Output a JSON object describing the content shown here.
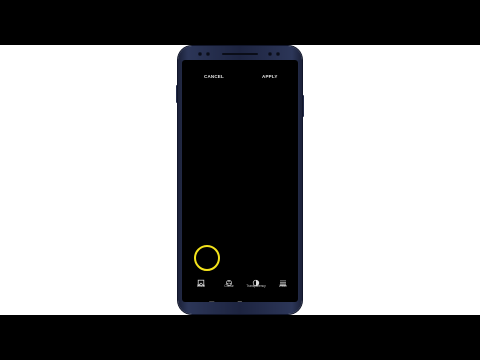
{
  "screen": {
    "cancel_label": "CANCEL",
    "apply_label": "APPLY"
  },
  "toolbar": {
    "items": [
      {
        "label": "Effect",
        "icon": "effect-icon"
      },
      {
        "label": "Colour",
        "icon": "colour-icon"
      },
      {
        "label": "Transparency",
        "icon": "transparency-icon"
      },
      {
        "label": "Width",
        "icon": "width-icon"
      }
    ]
  },
  "navbar": {
    "items": [
      "recents-icon",
      "home-icon",
      "back-icon"
    ]
  },
  "highlight": {
    "color": "#f3e21b",
    "target": "Effect"
  },
  "colors": {
    "phone_body": "#1d2440",
    "screen_bg": "#000000",
    "outer_bg": "#000000",
    "canvas_bg": "#ffffff"
  }
}
